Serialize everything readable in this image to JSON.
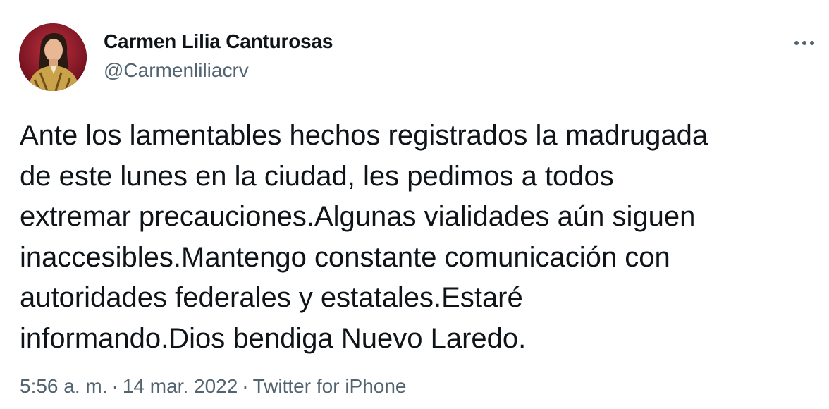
{
  "author": {
    "name": "Carmen Lilia Canturosas",
    "handle": "@Carmenliliacrv"
  },
  "more_icon": "ellipsis-icon",
  "tweet": {
    "lines": [
      "Ante los lamentables hechos registrados la madrugada",
      "de este lunes en la ciudad, les pedimos a todos",
      "extremar precauciones.Algunas vialidades aún siguen",
      "inaccesibles.Mantengo constante comunicación con",
      "autoridades federales y estatales.Estaré",
      "informando.Dios bendiga Nuevo Laredo."
    ]
  },
  "meta": {
    "time": "5:56 a. m.",
    "separator": "·",
    "date": "14 mar. 2022",
    "source": "Twitter for iPhone"
  },
  "colors": {
    "text_primary": "#0f1419",
    "text_secondary": "#536471",
    "avatar_background": "#7a1020"
  }
}
